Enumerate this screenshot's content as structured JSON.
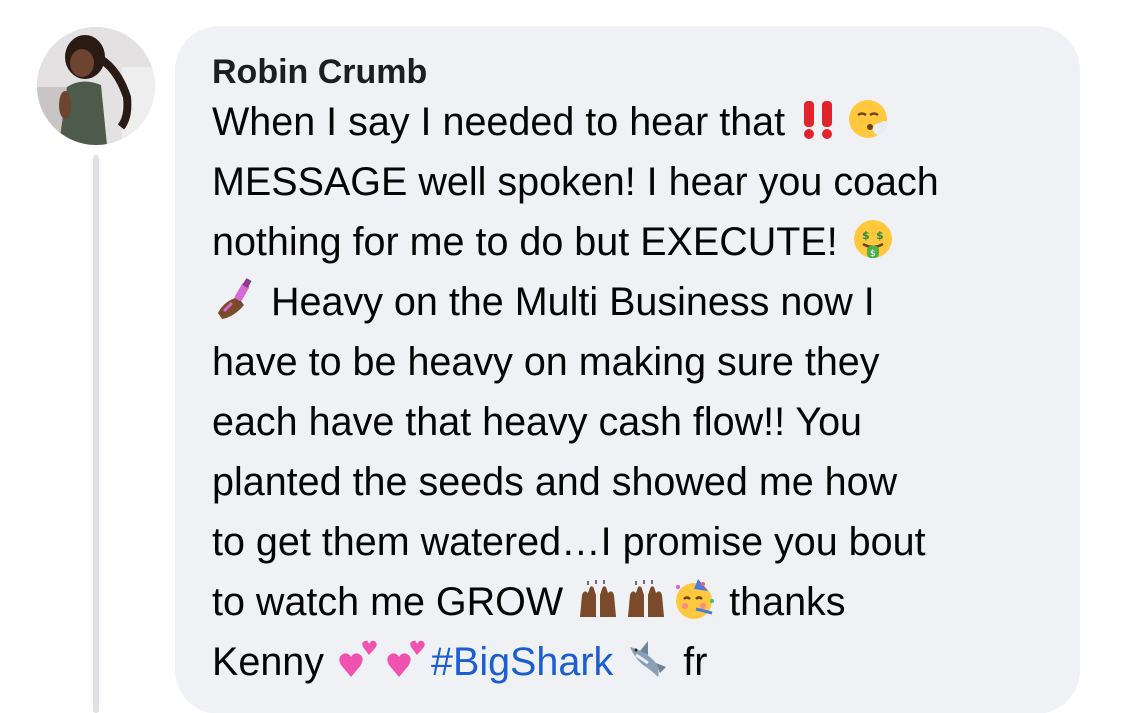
{
  "comment": {
    "author": "Robin Crumb",
    "lines": [
      "When I say I needed to hear that",
      "MESSAGE well spoken! I hear you coach",
      "nothing for me to do but EXECUTE!",
      "Heavy on the Multi Business now I",
      "have to be heavy on making sure they",
      "each have that heavy cash flow!! You",
      "planted the seeds and showed me how",
      "to get them watered…I promise you bout",
      "to watch me GROW",
      "thanks",
      "Kenny",
      "#BigShark",
      "fr"
    ],
    "emojis": {
      "line1": [
        "double-exclamation-icon",
        "face-exhaling-icon"
      ],
      "line3": [
        "money-mouth-face-icon"
      ],
      "line4_start": [
        "nail-polish-icon"
      ],
      "line9": [
        "raising-hands-icon",
        "raising-hands-icon",
        "partying-face-icon"
      ],
      "line10": [
        "two-hearts-icon",
        "two-hearts-icon",
        "shark-icon"
      ]
    },
    "colors": {
      "bubble_bg": "#f0f1f5",
      "text": "#050505",
      "hashtag": "#1a5ed2",
      "thread_line": "#e0e1e5"
    }
  }
}
